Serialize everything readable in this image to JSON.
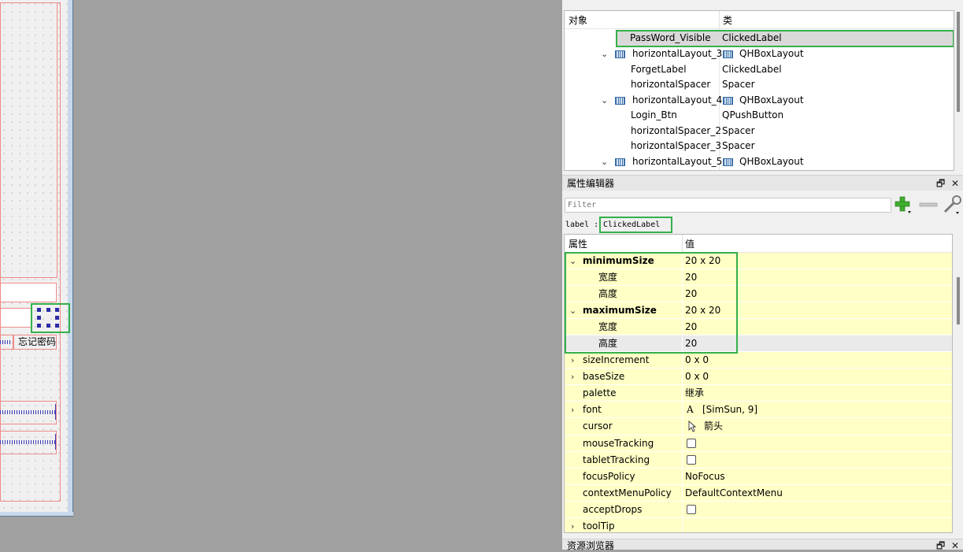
{
  "canvas": {
    "forget_label": "忘记密码"
  },
  "object_inspector": {
    "header": {
      "object_col": "对象",
      "class_col": "类"
    },
    "rows": [
      {
        "name": "PassWord_Visible",
        "class": "ClickedLabel"
      },
      {
        "name": "horizontalLayout_3",
        "class": "QHBoxLayout"
      },
      {
        "name": "ForgetLabel",
        "class": "ClickedLabel"
      },
      {
        "name": "horizontalSpacer",
        "class": "Spacer"
      },
      {
        "name": "horizontalLayout_4",
        "class": "QHBoxLayout"
      },
      {
        "name": "Login_Btn",
        "class": "QPushButton"
      },
      {
        "name": "horizontalSpacer_2",
        "class": "Spacer"
      },
      {
        "name": "horizontalSpacer_3",
        "class": "Spacer"
      },
      {
        "name": "horizontalLayout_5",
        "class": "QHBoxLayout"
      }
    ]
  },
  "property_editor": {
    "title": "属性编辑器",
    "filter_placeholder": "Filter",
    "object_name": "label",
    "separator": ":",
    "class_name": "ClickedLabel",
    "header": {
      "property_col": "属性",
      "value_col": "值"
    },
    "rows": [
      {
        "name": "minimumSize",
        "value": "20 x 20"
      },
      {
        "name": "宽度",
        "value": "20"
      },
      {
        "name": "高度",
        "value": "20"
      },
      {
        "name": "maximumSize",
        "value": "20 x 20"
      },
      {
        "name": "宽度",
        "value": "20"
      },
      {
        "name": "高度",
        "value": "20"
      },
      {
        "name": "sizeIncrement",
        "value": "0 x 0"
      },
      {
        "name": "baseSize",
        "value": "0 x 0"
      },
      {
        "name": "palette",
        "value": "继承"
      },
      {
        "name": "font",
        "value": "[SimSun, 9]"
      },
      {
        "name": "cursor",
        "value": "箭头"
      },
      {
        "name": "mouseTracking",
        "value": false
      },
      {
        "name": "tabletTracking",
        "value": false
      },
      {
        "name": "focusPolicy",
        "value": "NoFocus"
      },
      {
        "name": "contextMenuPolicy",
        "value": "DefaultContextMenu"
      },
      {
        "name": "acceptDrops",
        "value": false
      },
      {
        "name": "toolTip",
        "value": ""
      }
    ]
  },
  "resource_browser": {
    "title": "资源浏览器"
  },
  "title_buttons": {
    "float": "🗗",
    "close": "✕"
  },
  "colors": {
    "highlight": "#35b04a",
    "property_bg": "#ffffc6",
    "selection": "#d9d9d9"
  }
}
